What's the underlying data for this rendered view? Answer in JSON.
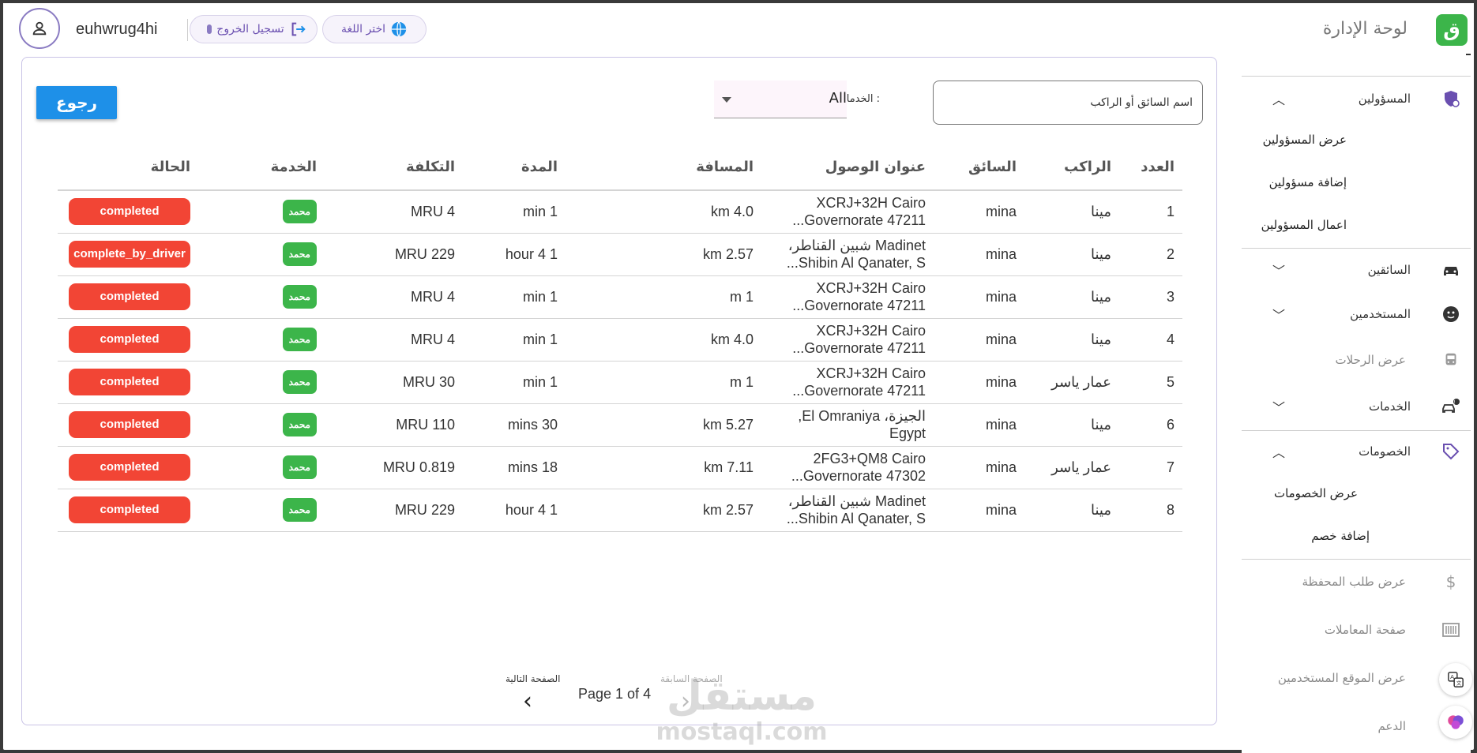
{
  "header": {
    "username": "euhwrug4hi",
    "logout_label": "تسجيل الخروج",
    "language_label": "اختر اللغة",
    "app_title": "لوحة الإدارة",
    "logo_glyph": "ق"
  },
  "sidebar": {
    "admins": {
      "label": "المسؤولين",
      "subitems": [
        "عرض المسؤولين",
        "إضافة مسؤولين",
        "اعمال المسؤولين"
      ]
    },
    "drivers_label": "السائقين",
    "users_label": "المستخدمين",
    "trips_label": "عرض الرحلات",
    "services_label": "الخدمات",
    "discounts": {
      "label": "الخصومات",
      "subitems": [
        "عرض الخصومات",
        "إضافة خصم"
      ]
    },
    "wallet_label": "عرض طلب المحفظة",
    "transactions_label": "صفحة المعاملات",
    "locations_label": "عرض الموقع المستخدمين",
    "support_label": "الدعم"
  },
  "toolbar": {
    "back_label": "رجوع",
    "search_placeholder": "اسم السائق أو الراكب",
    "service_filter_label": "الخدمات :",
    "service_filter_value": "All"
  },
  "table": {
    "headers": [
      "العدد",
      "الراكب",
      "السائق",
      "عنوان الوصول",
      "المسافة",
      "المدة",
      "التكلفة",
      "الخدمة",
      "الحالة"
    ],
    "rows": [
      {
        "num": "1",
        "rider": "مينا",
        "driver": "mina",
        "addr1": "XCRJ+32H Cairo",
        "addr2": "Governorate 47211...",
        "distance": "4.0 km",
        "duration": "1 min",
        "cost": "4 MRU",
        "service": "محمد",
        "status": "completed"
      },
      {
        "num": "2",
        "rider": "مينا",
        "driver": "mina",
        "addr1": "Madinet شبين القناطر،",
        "addr2": "Shibin Al Qanater, S...",
        "distance": "2.57 km",
        "duration": "1 4 hour",
        "cost": "229 MRU",
        "service": "محمد",
        "status": "complete_by_driver"
      },
      {
        "num": "3",
        "rider": "مينا",
        "driver": "mina",
        "addr1": "XCRJ+32H Cairo",
        "addr2": "Governorate 47211...",
        "distance": "1 m",
        "duration": "1 min",
        "cost": "4 MRU",
        "service": "محمد",
        "status": "completed"
      },
      {
        "num": "4",
        "rider": "مينا",
        "driver": "mina",
        "addr1": "XCRJ+32H Cairo",
        "addr2": "Governorate 47211...",
        "distance": "4.0 km",
        "duration": "1 min",
        "cost": "4 MRU",
        "service": "محمد",
        "status": "completed"
      },
      {
        "num": "5",
        "rider": "عمار ياسر",
        "driver": "mina",
        "addr1": "XCRJ+32H Cairo",
        "addr2": "Governorate 47211...",
        "distance": "1 m",
        "duration": "1 min",
        "cost": "30 MRU",
        "service": "محمد",
        "status": "completed"
      },
      {
        "num": "6",
        "rider": "مينا",
        "driver": "mina",
        "addr1": "الجيزة، El Omraniya,",
        "addr2": "Egypt",
        "distance": "5.27 km",
        "duration": "30 mins",
        "cost": "110 MRU",
        "service": "محمد",
        "status": "completed"
      },
      {
        "num": "7",
        "rider": "عمار ياسر",
        "driver": "mina",
        "addr1": "2FG3+QM8 Cairo",
        "addr2": "Governorate 47302...",
        "distance": "7.11 km",
        "duration": "18 mins",
        "cost": "0.819 MRU",
        "service": "محمد",
        "status": "completed"
      },
      {
        "num": "8",
        "rider": "مينا",
        "driver": "mina",
        "addr1": "Madinet شبين القناطر،",
        "addr2": "Shibin Al Qanater, S...",
        "distance": "2.57 km",
        "duration": "1 4 hour",
        "cost": "229 MRU",
        "service": "محمد",
        "status": "completed"
      }
    ]
  },
  "pagination": {
    "info": "Page 1 of 4",
    "next_label": "الصفحة التالية",
    "prev_label": "الصفحة السابقة"
  },
  "watermark": {
    "ar": "مستقل",
    "en": "mostaql.com"
  },
  "colors": {
    "status_red": "#f24535",
    "service_green": "#3cb54a",
    "accent_blue": "#1e90e8",
    "brand_purple": "#6a4fb0"
  }
}
